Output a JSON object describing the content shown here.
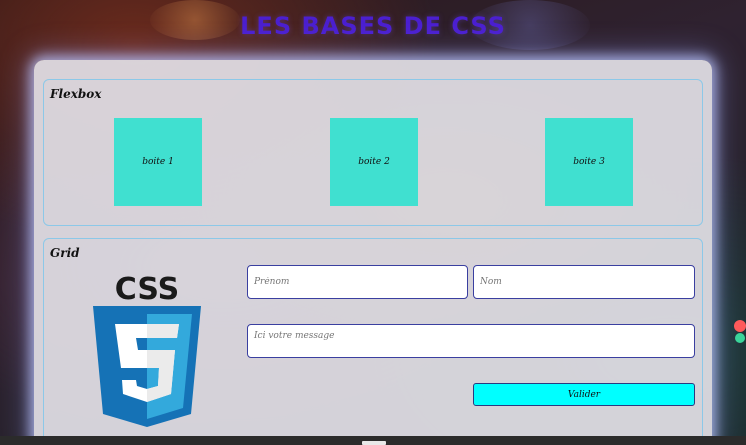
{
  "page": {
    "title": "LES BASES DE CSS"
  },
  "flexbox": {
    "title": "Flexbox",
    "boxes": [
      "boite 1",
      "boite 2",
      "boite 3"
    ]
  },
  "grid": {
    "title": "Grid",
    "logo": {
      "text": "CSS",
      "number": "3",
      "icon": "css3-logo-icon"
    },
    "form": {
      "prenom_placeholder": "Prénom",
      "nom_placeholder": "Nom",
      "message_placeholder": "Ici votre message",
      "submit_label": "Valider"
    }
  },
  "colors": {
    "title": "#4b1fd0",
    "box": "#40e0d0",
    "button": "#00ffff",
    "section_border": "#8cc8e8",
    "css3_dark": "#1572b6",
    "css3_light": "#33a9dc"
  }
}
